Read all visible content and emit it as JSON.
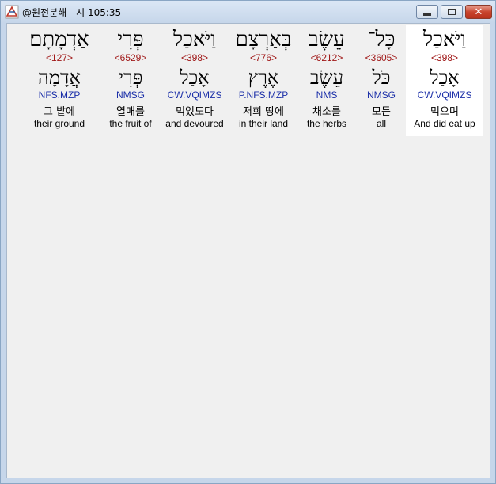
{
  "window": {
    "title": "@원전분해 - 시 105:35"
  },
  "words": [
    {
      "hebrew": "וַיֹּאכַל",
      "strongs": "<398>",
      "lexeme": "אָכַל",
      "parse": "CW.VQIMZS",
      "korean": "먹으며",
      "english": "And did eat up",
      "selected": true
    },
    {
      "hebrew": "כָּל־",
      "strongs": "<3605>",
      "lexeme": "כֹּל",
      "parse": "NMSG",
      "korean": "모든",
      "english": "all",
      "selected": false
    },
    {
      "hebrew": "עֵשֶׂב",
      "strongs": "<6212>",
      "lexeme": "עֵשֶׂב",
      "parse": "NMS",
      "korean": "채소를",
      "english": "the herbs",
      "selected": false
    },
    {
      "hebrew": "בְּאַרְצָם",
      "strongs": "<776>",
      "lexeme": "אֶרֶץ",
      "parse": "P.NFS.MZP",
      "korean": "저희 땅에",
      "english": "in their land",
      "selected": false
    },
    {
      "hebrew": "וַיֹּאכַל",
      "strongs": "<398>",
      "lexeme": "אָכַל",
      "parse": "CW.VQIMZS",
      "korean": "먹었도다",
      "english": "and devoured",
      "selected": false
    },
    {
      "hebrew": "פְּרִי",
      "strongs": "<6529>",
      "lexeme": "פְּרִי",
      "parse": "NMSG",
      "korean": "열매를",
      "english": "the fruit of",
      "selected": false
    },
    {
      "hebrew": "אַדְמָתָם׃",
      "strongs": "<127>",
      "lexeme": "אֲדָמָה",
      "parse": "NFS.MZP",
      "korean": "그 밭에",
      "english": "their ground",
      "selected": false
    }
  ]
}
